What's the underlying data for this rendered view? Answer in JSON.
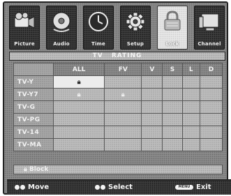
{
  "tabs": [
    {
      "label": "Picture",
      "icon": "camcorder-icon",
      "active": false
    },
    {
      "label": "Audio",
      "icon": "disc-icon",
      "active": false
    },
    {
      "label": "Time",
      "icon": "clock-icon",
      "active": false
    },
    {
      "label": "Setup",
      "icon": "gear-icon",
      "active": false
    },
    {
      "label": "Lock",
      "icon": "lock-icon",
      "active": true
    },
    {
      "label": "Channel",
      "icon": "monitor-icon",
      "active": false
    }
  ],
  "header": {
    "left": "TV",
    "right": "RATING"
  },
  "grid": {
    "columns": [
      "",
      "ALL",
      "FV",
      "V",
      "S",
      "L",
      "D"
    ],
    "rows": [
      {
        "label": "TV-Y",
        "cells": [
          "lock",
          "",
          "",
          "",
          "",
          ""
        ]
      },
      {
        "label": "TV-Y7",
        "cells": [
          "lock",
          "lock",
          "",
          "",
          "",
          ""
        ]
      },
      {
        "label": "TV-G",
        "cells": [
          "",
          "",
          "",
          "",
          "",
          ""
        ]
      },
      {
        "label": "TV-PG",
        "cells": [
          "",
          "",
          "",
          "",
          "",
          ""
        ]
      },
      {
        "label": "TV-14",
        "cells": [
          "",
          "",
          "",
          "",
          "",
          ""
        ]
      },
      {
        "label": "TV-MA",
        "cells": [
          "",
          "",
          "",
          "",
          "",
          ""
        ]
      }
    ]
  },
  "legend": {
    "icon": "lock-icon",
    "text": "Block"
  },
  "footer": {
    "move": "Move",
    "select": "Select",
    "menu_key": "MENU",
    "exit": "Exit"
  }
}
